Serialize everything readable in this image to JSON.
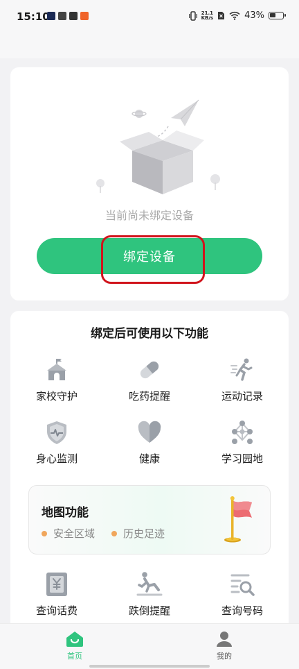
{
  "status_bar": {
    "time": "15:10",
    "net_speed_value": "21.1",
    "net_speed_unit": "KB/s",
    "battery": "43%"
  },
  "bind_card": {
    "empty_text": "当前尚未绑定设备",
    "bind_button_label": "绑定设备"
  },
  "features_card": {
    "title": "绑定后可使用以下功能",
    "row1": [
      {
        "label": "家校守护",
        "icon": "school-guard-icon"
      },
      {
        "label": "吃药提醒",
        "icon": "pill-icon"
      },
      {
        "label": "运动记录",
        "icon": "running-icon"
      }
    ],
    "row2": [
      {
        "label": "身心监测",
        "icon": "shield-heartbeat-icon"
      },
      {
        "label": "健康",
        "icon": "heart-icon"
      },
      {
        "label": "学习园地",
        "icon": "network-icon"
      }
    ],
    "map": {
      "title": "地图功能",
      "items": [
        "安全区域",
        "历史足迹"
      ]
    },
    "row3": [
      {
        "label": "查询话费",
        "icon": "yen-receipt-icon"
      },
      {
        "label": "跌倒提醒",
        "icon": "fall-person-icon"
      },
      {
        "label": "查询号码",
        "icon": "search-list-icon"
      }
    ]
  },
  "bottom_nav": {
    "home_label": "首页",
    "mine_label": "我的"
  },
  "colors": {
    "accent": "#2fc47e",
    "highlight": "#d0141c",
    "icon_gray": "#9aa0a8"
  }
}
